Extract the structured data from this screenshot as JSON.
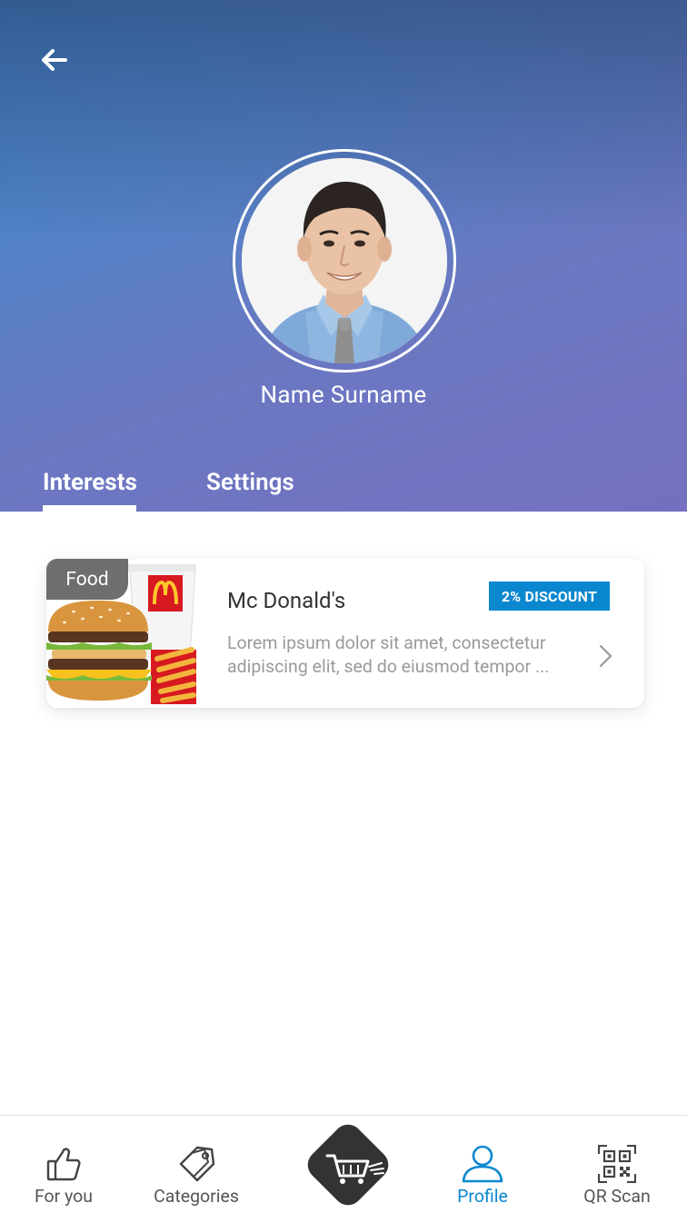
{
  "header": {
    "profile_name": "Name Surname",
    "tabs": [
      {
        "label": "Interests",
        "active": true
      },
      {
        "label": "Settings",
        "active": false
      }
    ],
    "gradient_colors": [
      "#3c86c8",
      "#7570c0"
    ]
  },
  "interests": [
    {
      "category": "Food",
      "title": "Mc Donald's",
      "badge": "2% DISCOUNT",
      "description": "Lorem ipsum dolor sit amet, consectetur adipiscing elit, sed do eiusmod tempor ..."
    }
  ],
  "bottom_nav": {
    "items": [
      {
        "label": "For you",
        "icon": "thumbs-up-icon",
        "active": false
      },
      {
        "label": "Categories",
        "icon": "tag-icon",
        "active": false
      },
      {
        "label": "",
        "icon": "cart-icon",
        "active": false
      },
      {
        "label": "Profile",
        "icon": "user-icon",
        "active": true
      },
      {
        "label": "QR Scan",
        "icon": "qr-code-icon",
        "active": false
      }
    ]
  },
  "colors": {
    "accent": "#0a87cf",
    "tag_bg": "#6e6e6e",
    "fab_bg": "#333333"
  }
}
